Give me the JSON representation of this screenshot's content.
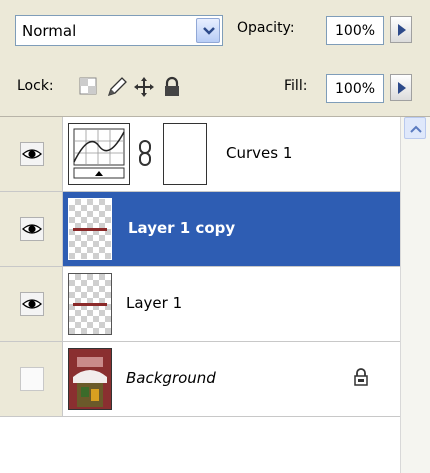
{
  "blend_mode": {
    "value": "Normal",
    "dropdown_icon": "chevron-down-icon"
  },
  "opacity": {
    "label": "Opacity:",
    "value": "100%",
    "stepper_icon": "arrow-right-icon"
  },
  "lock": {
    "label": "Lock:",
    "options": [
      {
        "name": "lock-transparent-pixels-icon"
      },
      {
        "name": "lock-image-pixels-icon"
      },
      {
        "name": "lock-position-icon"
      },
      {
        "name": "lock-all-icon"
      }
    ]
  },
  "fill": {
    "label": "Fill:",
    "value": "100%",
    "stepper_icon": "arrow-right-icon"
  },
  "layers": [
    {
      "name": "Curves 1",
      "visible": true,
      "selected": false,
      "type": "adjustment-curves"
    },
    {
      "name": "Layer 1 copy",
      "visible": true,
      "selected": true,
      "type": "pixel"
    },
    {
      "name": "Layer 1",
      "visible": true,
      "selected": false,
      "type": "pixel"
    },
    {
      "name": "Background",
      "visible": false,
      "selected": false,
      "type": "background",
      "locked": true
    }
  ],
  "colors": {
    "selection": "#2e5db3",
    "panel": "#ece9d8"
  }
}
